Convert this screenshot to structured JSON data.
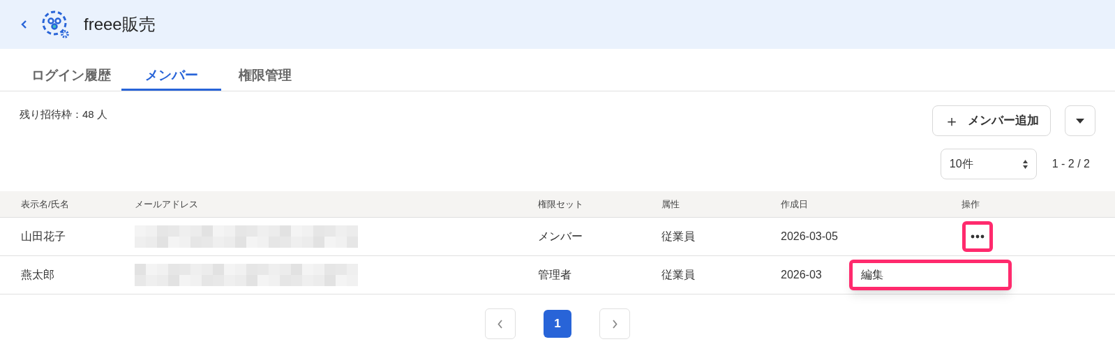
{
  "header": {
    "title": "freee販売"
  },
  "tabs": [
    {
      "label": "ログイン履歴",
      "selected": false
    },
    {
      "label": "メンバー",
      "selected": true
    },
    {
      "label": "権限管理",
      "selected": false
    }
  ],
  "remaining_invites": "残り招待枠：48 人",
  "add_button": {
    "icon": "＋",
    "label": "メンバー追加"
  },
  "page_size": {
    "value": "10件"
  },
  "range": "1 - 2 / 2",
  "table": {
    "columns": [
      "表示名/氏名",
      "メールアドレス",
      "権限セット",
      "属性",
      "作成日",
      "操作"
    ],
    "rows": [
      {
        "name": "山田花子",
        "permission": "メンバー",
        "attribute": "従業員",
        "created": "2026-03-05",
        "menu_open": true
      },
      {
        "name": "燕太郎",
        "permission": "管理者",
        "attribute": "従業員",
        "created": "2026-03"
      }
    ]
  },
  "row_menu": {
    "items": [
      "編集"
    ]
  },
  "pagination": {
    "pages": [
      {
        "label": "1",
        "selected": true
      }
    ]
  }
}
